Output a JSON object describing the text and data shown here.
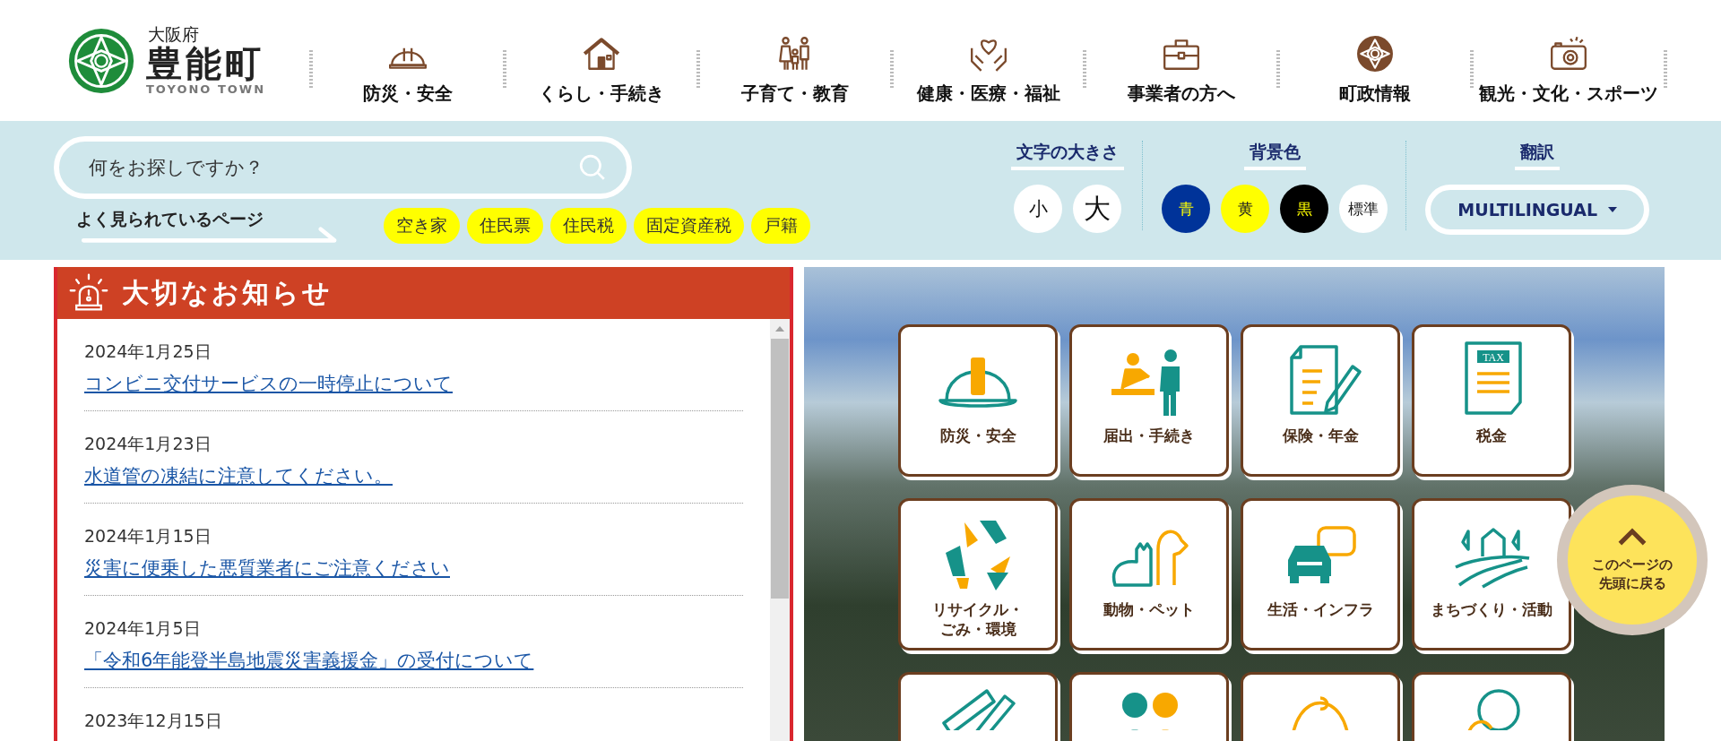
{
  "logo": {
    "prefecture": "大阪府",
    "town": "豊能町",
    "romaji": "TOYONO TOWN"
  },
  "nav": [
    {
      "label": "防災・安全"
    },
    {
      "label": "くらし・手続き"
    },
    {
      "label": "子育て・教育"
    },
    {
      "label": "健康・医療・福祉"
    },
    {
      "label": "事業者の方へ"
    },
    {
      "label": "町政情報"
    },
    {
      "label": "観光・文化・スポーツ"
    }
  ],
  "search": {
    "placeholder": "何をお探しですか？"
  },
  "popular": {
    "label": "よく見られているページ",
    "tags": [
      "空き家",
      "住民票",
      "住民税",
      "固定資産税",
      "戸籍"
    ]
  },
  "font_size": {
    "label": "文字の大きさ",
    "buttons": [
      {
        "label": "小",
        "kind": "small"
      },
      {
        "label": "大",
        "kind": "large"
      }
    ]
  },
  "background_color": {
    "label": "背景色",
    "options": [
      {
        "label": "青",
        "color": "#003399"
      },
      {
        "label": "黄",
        "color": "#ffff00"
      },
      {
        "label": "黒",
        "color": "#000000"
      },
      {
        "label": "標準",
        "color": "#ffffff"
      }
    ]
  },
  "translate": {
    "label": "翻訳",
    "button": "MULTILINGUAL"
  },
  "notices": {
    "title": "大切なお知らせ",
    "items": [
      {
        "date": "2024年1月25日",
        "title": "コンビニ交付サービスの一時停止について"
      },
      {
        "date": "2024年1月23日",
        "title": "水道管の凍結に注意してください。"
      },
      {
        "date": "2024年1月15日",
        "title": "災害に便乗した悪質業者にご注意ください"
      },
      {
        "date": "2024年1月5日",
        "title": "「令和6年能登半島地震災害義援金」の受付について"
      },
      {
        "date": "2023年12月15日"
      }
    ]
  },
  "tiles": [
    {
      "label": [
        "防災・安全"
      ]
    },
    {
      "label": [
        "届出・手続き"
      ]
    },
    {
      "label": [
        "保険・年金"
      ]
    },
    {
      "label": [
        "税金"
      ],
      "icon_text": "TAX"
    },
    {
      "label": [
        "リサイクル・",
        "ごみ・環境"
      ]
    },
    {
      "label": [
        "動物・ペット"
      ]
    },
    {
      "label": [
        "生活・インフラ"
      ]
    },
    {
      "label": [
        "まちづくり・活動"
      ]
    }
  ],
  "back_to_top": {
    "label": [
      "このページの",
      "先頭に戻る"
    ]
  }
}
